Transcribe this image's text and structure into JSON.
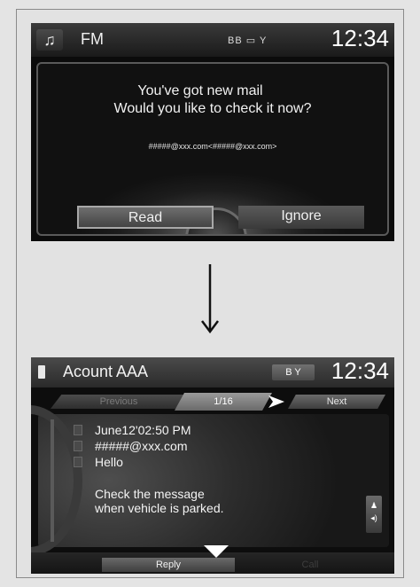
{
  "screen1": {
    "source_label": "FM",
    "status_icons": "BB ▭ Y",
    "clock": "12:34",
    "message_line1": "You've got new mail",
    "message_line2": "Would you like to check it now?",
    "sender_address": "#####@xxx.com<#####@xxx.com>",
    "read_button": "Read",
    "ignore_button": "Ignore",
    "icons": [
      "music-note-icon",
      "bluetooth-icon",
      "battery-icon",
      "signal-icon"
    ]
  },
  "arrow": {
    "icon": "down-arrow-icon"
  },
  "screen2": {
    "account_label": "Acount AAA",
    "status_icons": "B Y",
    "clock": "12:34",
    "nav": {
      "previous": "Previous",
      "page": "1/16",
      "next": "Next"
    },
    "message": {
      "datetime": "June12'02:50 PM",
      "from": "#####@xxx.com",
      "subject": "Hello",
      "notice_line1": "Check the message",
      "notice_line2": "when vehicle is parked."
    },
    "bottom": {
      "reply": "Reply",
      "call": "Call"
    },
    "icons": [
      "phone-icon",
      "bluetooth-icon",
      "signal-icon",
      "next-arrow-icon",
      "voice-icon",
      "down-chevron-icon"
    ]
  },
  "colors": {
    "background": "#e4e4e4",
    "screen": "#0b0b0b",
    "text": "#f2f2f2",
    "disabled_text": "#7a7a7a"
  }
}
